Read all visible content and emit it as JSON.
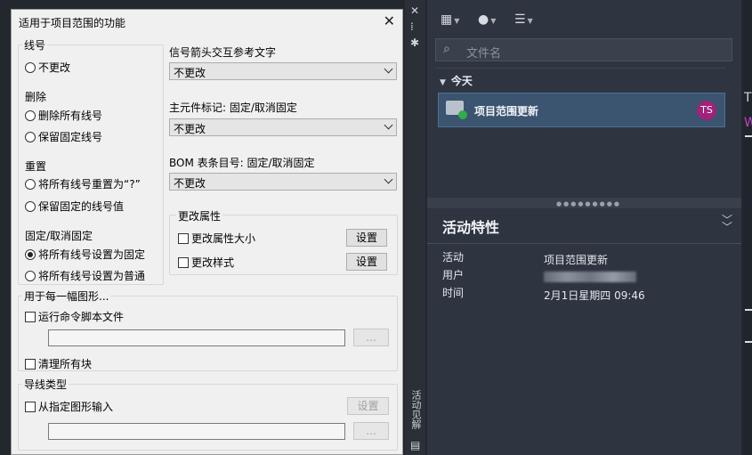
{
  "dialog": {
    "title": "适用于项目范围的功能",
    "close": "✕",
    "wire_number": {
      "title": "线号",
      "no_change": "不更改",
      "delete_label": "删除",
      "delete_all": "删除所有线号",
      "keep_fixed": "保留固定线号",
      "reset_label": "重置",
      "reset_all": "将所有线号重置为“?”",
      "keep_fixed_value": "保留固定的线号值",
      "fix_label": "固定/取消固定",
      "set_fixed": "将所有线号设置为固定",
      "set_normal": "将所有线号设置为普通"
    },
    "signal_label": "信号箭头交互参考文字",
    "signal_value": "不更改",
    "parent_label": "主元件标记: 固定/取消固定",
    "parent_value": "不更改",
    "bom_label": "BOM 表条目号: 固定/取消固定",
    "bom_value": "不更改",
    "attributes": {
      "title": "更改属性",
      "size": "更改属性大小",
      "style": "更改样式",
      "set_button": "设置"
    },
    "each_drawing": {
      "title": "用于每一幅图形...",
      "run_script": "运行命令脚本文件",
      "browse": "...",
      "purge": "清理所有块"
    },
    "wire_type": {
      "title": "导线类型",
      "from_drawing": "从指定图形输入",
      "set_button": "设置",
      "browse": "..."
    }
  },
  "strip": {
    "close": "✕",
    "pin": "⁞",
    "gear": "✱",
    "label": "活动见解"
  },
  "palette": {
    "search_placeholder": "文件名",
    "today": "今天",
    "item_name": "项目范围更新",
    "avatar": "TS",
    "props_title": "活动特性",
    "rows": [
      {
        "key": "活动",
        "value": "项目范围更新"
      },
      {
        "key": "用户",
        "value": ""
      },
      {
        "key": "时间",
        "value": "2月1日星期四 09:46"
      }
    ]
  },
  "farright": {
    "t": "T",
    "w": "W"
  }
}
